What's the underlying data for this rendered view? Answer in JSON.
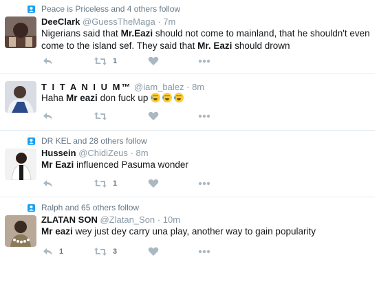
{
  "colors": {
    "context_icon": "#1da1f2",
    "action_icon": "#aab8c2",
    "name_text": "#14171a",
    "meta_text": "#8899a6",
    "separator": "#e1e8ed"
  },
  "icons": {
    "context": "follow-person-icon",
    "reply": "reply-arrow-icon",
    "retweet": "retweet-icon",
    "like": "heart-icon",
    "more": "more-dots-icon",
    "emoji": "tears-of-joy-emoji"
  },
  "tweets": [
    {
      "context": "Peace is Priceless and 4 others follow",
      "name": "DeeClark",
      "handle": "@GuessTheMaga",
      "time": "· 7m",
      "text_parts": [
        "Nigerians said that ",
        "Mr.Eazi",
        " should not come to mainland, that he shouldn't even come to the island sef. They said that ",
        "Mr. Eazi",
        " should drown"
      ],
      "retweet_count": "1",
      "like_count": ""
    },
    {
      "context": "",
      "name": "T I T A N I U M™",
      "handle": "@iam_balez",
      "time": "· 8m",
      "text_parts": [
        "Haha ",
        "Mr eazi",
        " don fuck up "
      ],
      "retweet_count": "",
      "like_count": ""
    },
    {
      "context": "DR KEL and 28 others follow",
      "name": "Hussein",
      "handle": "@ChidiZeus",
      "time": "· 8m",
      "text_parts": [
        "",
        "Mr Eazi",
        " influenced Pasuma wonder"
      ],
      "retweet_count": "1",
      "like_count": ""
    },
    {
      "context": "Ralph and 65 others follow",
      "name": "ZLATAN SON",
      "handle": "@Zlatan_Son",
      "time": "· 10m",
      "text_parts": [
        "",
        "Mr eazi",
        " wey just dey carry una play, another way to gain popularity"
      ],
      "reply_count": "1",
      "retweet_count": "3",
      "like_count": ""
    }
  ]
}
